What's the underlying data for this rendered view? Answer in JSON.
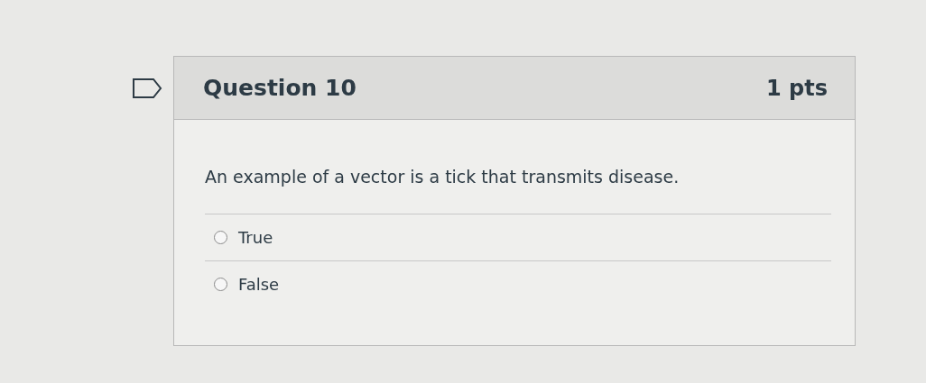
{
  "question": {
    "title": "Question 10",
    "points": "1 pts",
    "flagged": false,
    "text": "An example of a vector is a tick that transmits disease.",
    "answers": [
      {
        "label": "True",
        "selected": false
      },
      {
        "label": "False",
        "selected": false
      }
    ]
  }
}
